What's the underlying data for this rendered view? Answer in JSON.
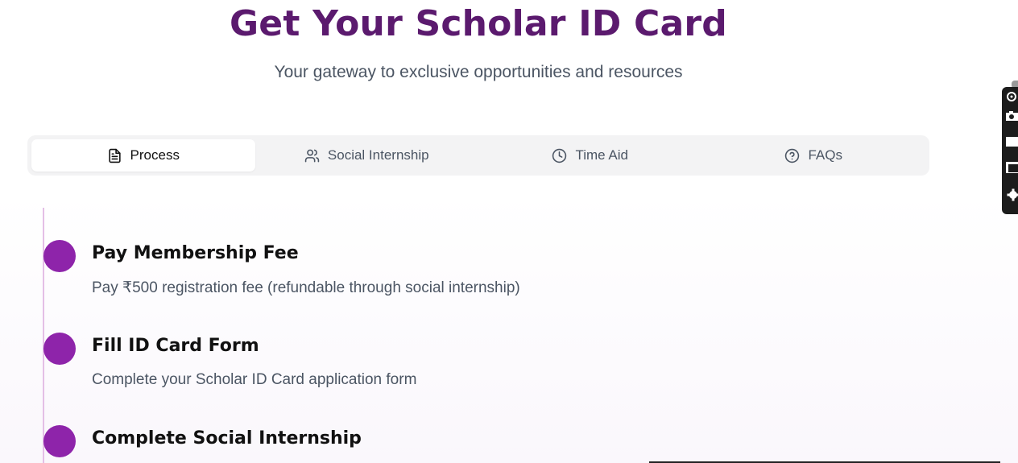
{
  "header": {
    "title": "Get Your Scholar ID Card",
    "subtitle": "Your gateway to exclusive opportunities and resources"
  },
  "tabs": [
    {
      "label": "Process",
      "icon": "document-icon",
      "active": true
    },
    {
      "label": "Social Internship",
      "icon": "users-icon",
      "active": false
    },
    {
      "label": "Time Aid",
      "icon": "clock-icon",
      "active": false
    },
    {
      "label": "FAQs",
      "icon": "help-circle-icon",
      "active": false
    }
  ],
  "steps": [
    {
      "title": "Pay Membership Fee",
      "description": "Pay ₹500 registration fee (refundable through social internship)"
    },
    {
      "title": "Fill ID Card Form",
      "description": "Complete your Scholar ID Card application form"
    },
    {
      "title": "Complete Social Internship",
      "description": ""
    }
  ],
  "colors": {
    "title": "#5b1a6e",
    "accent": "#8e24aa",
    "timeline": "#e4bfe6",
    "muted_text": "#4b5563",
    "tab_bg": "#f3f3f4"
  }
}
